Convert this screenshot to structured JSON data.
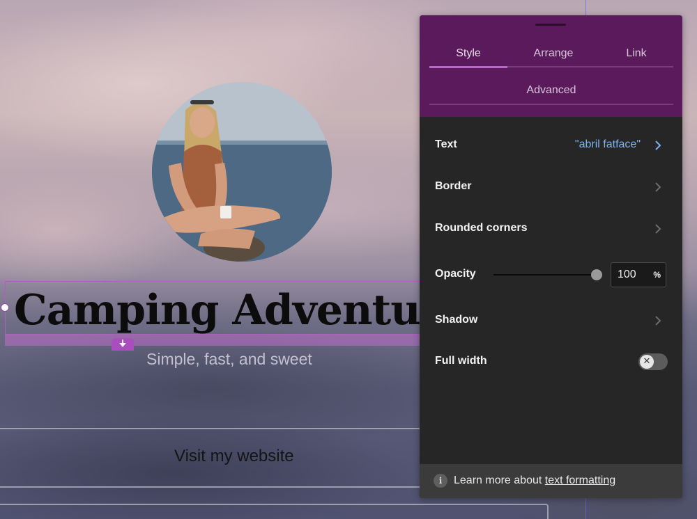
{
  "canvas": {
    "title": "Camping Adventur",
    "subtitle": "Simple, fast, and sweet",
    "link_button": "Visit my website",
    "avatar_icon": "avatar-photo",
    "drop_icon": "arrow-down-icon",
    "accent_color": "#a84fbd"
  },
  "panel": {
    "tabs": {
      "style": "Style",
      "arrange": "Arrange",
      "link": "Link",
      "advanced": "Advanced"
    },
    "active_tab": "Style",
    "rows": {
      "text": {
        "label": "Text",
        "value": "\"abril fatface\""
      },
      "border": {
        "label": "Border"
      },
      "rounded": {
        "label": "Rounded corners"
      },
      "opacity": {
        "label": "Opacity",
        "value": "100",
        "unit": "%",
        "level": 100
      },
      "shadow": {
        "label": "Shadow"
      },
      "full_width": {
        "label": "Full width",
        "enabled": false
      }
    },
    "footer": {
      "prefix": "Learn more about ",
      "link": "text formatting"
    },
    "colors": {
      "header": "#5a1a5c",
      "body": "#262626",
      "value": "#7cb2f0"
    }
  }
}
